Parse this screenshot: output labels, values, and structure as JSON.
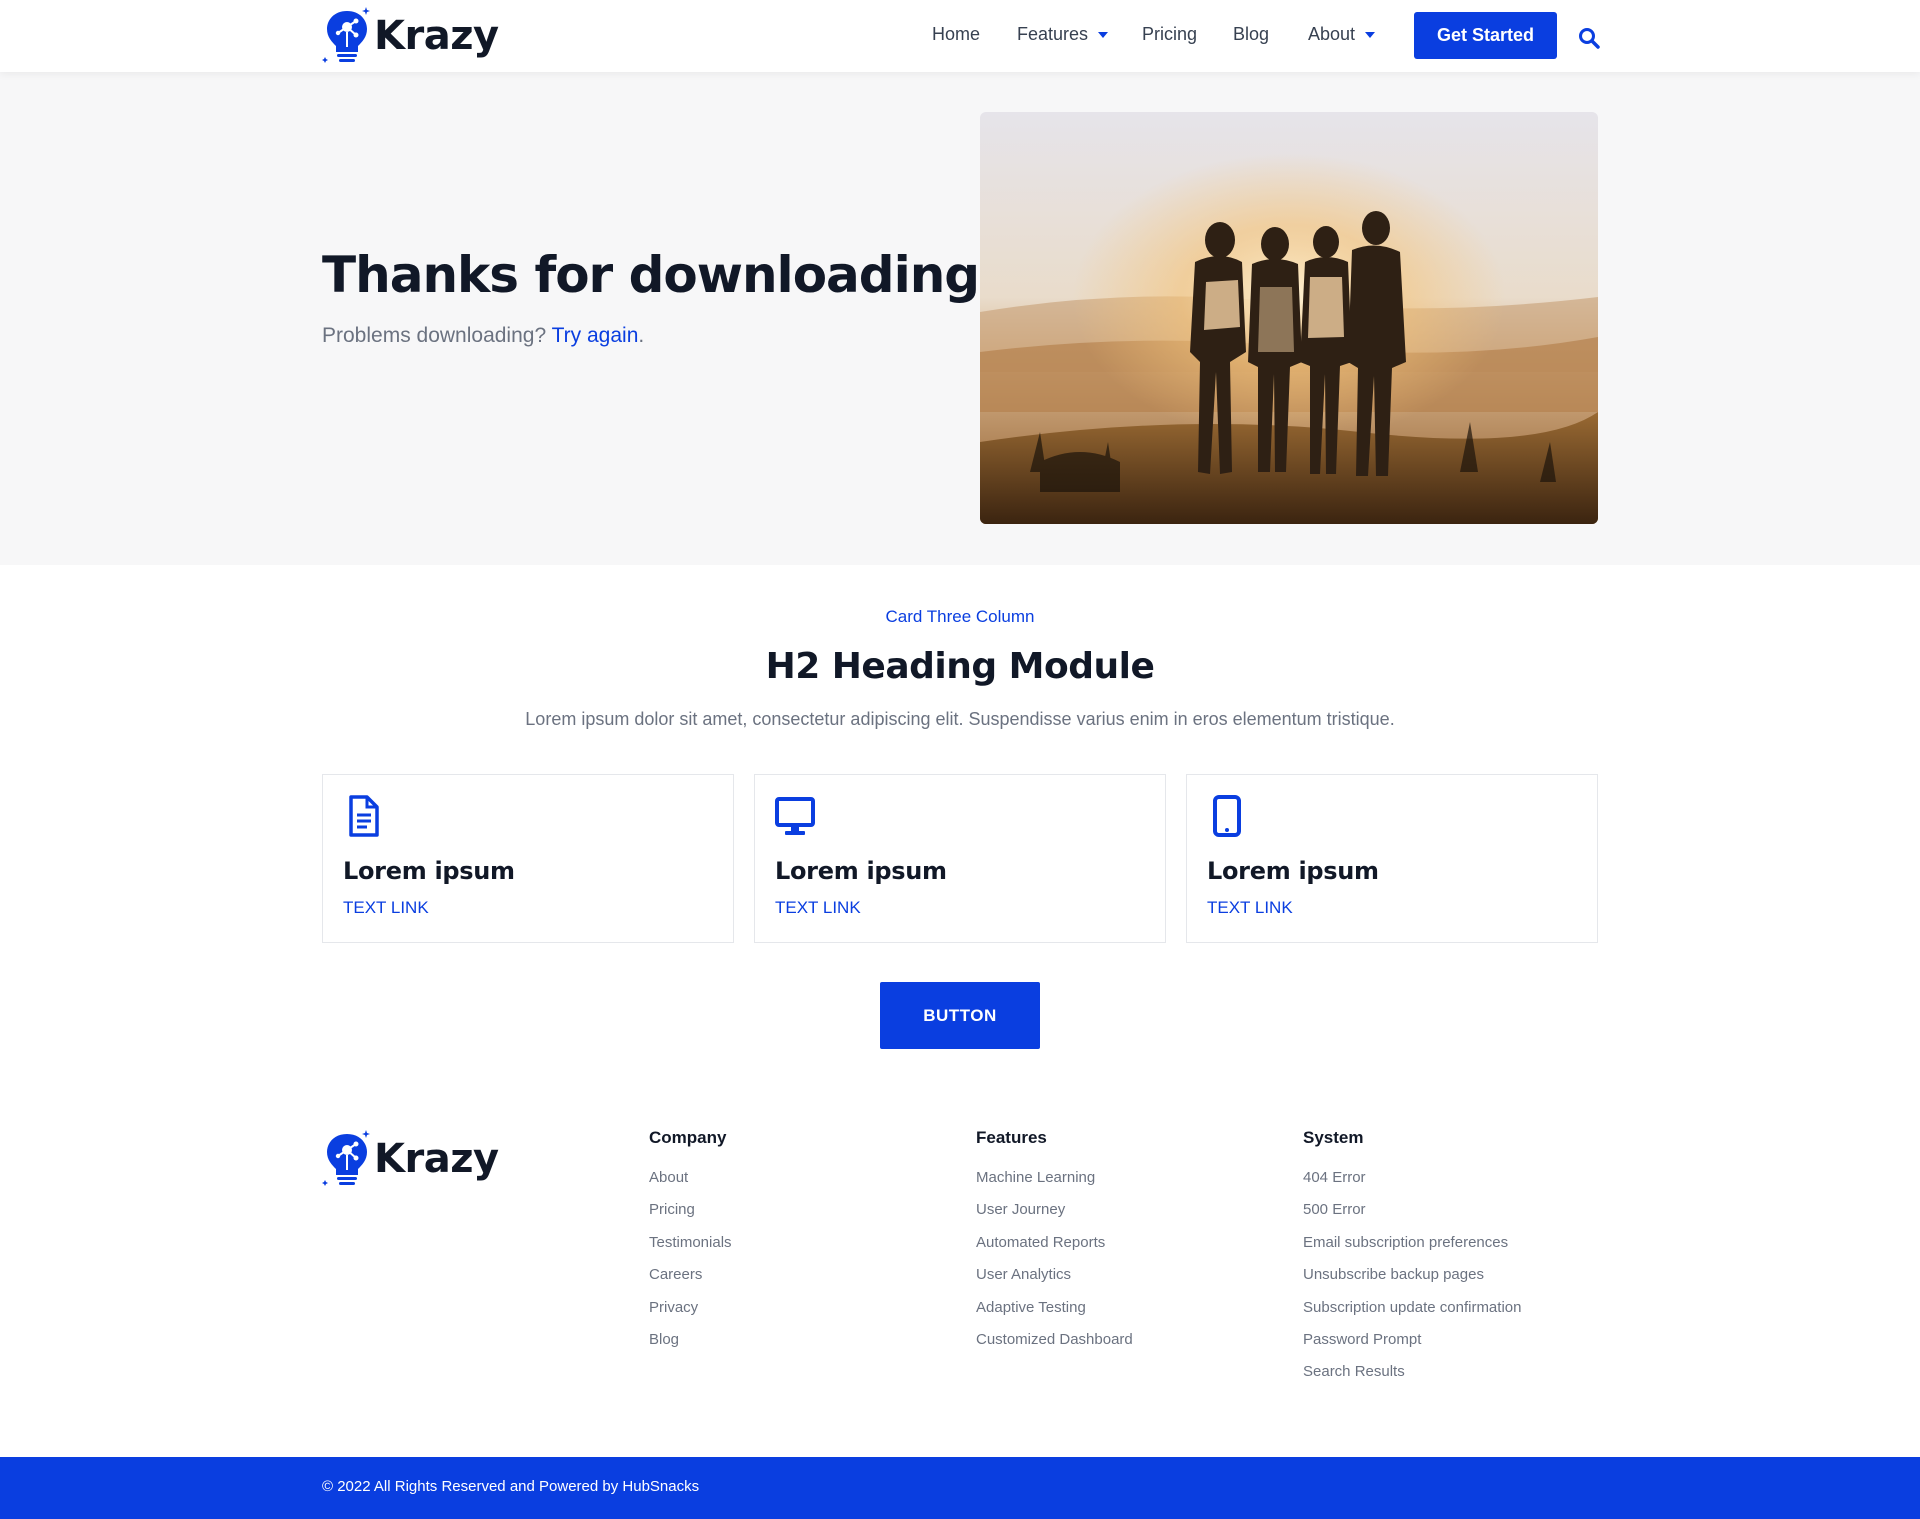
{
  "brand": {
    "name": "Krazy",
    "accent": "#0a3ee0"
  },
  "nav": {
    "items": [
      {
        "label": "Home",
        "dropdown": false
      },
      {
        "label": "Features",
        "dropdown": true
      },
      {
        "label": "Pricing",
        "dropdown": false
      },
      {
        "label": "Blog",
        "dropdown": false
      },
      {
        "label": "About",
        "dropdown": true
      }
    ],
    "cta_label": "Get Started",
    "search_icon": "search-icon"
  },
  "hero": {
    "title": "Thanks for downloading!",
    "sub_prefix": "Problems downloading?",
    "sub_link": "Try again",
    "sub_suffix": "."
  },
  "section": {
    "eyebrow": "Card Three Column",
    "heading": "H2 Heading Module",
    "lead": "Lorem ipsum dolor sit amet, consectetur adipiscing elit. Suspendisse varius enim in eros elementum tristique.",
    "button_label": "BUTTON"
  },
  "cards": [
    {
      "icon": "document-icon",
      "title": "Lorem ipsum",
      "link": "TEXT LINK"
    },
    {
      "icon": "desktop-icon",
      "title": "Lorem ipsum",
      "link": "TEXT LINK"
    },
    {
      "icon": "mobile-icon",
      "title": "Lorem ipsum",
      "link": "TEXT LINK"
    }
  ],
  "footer": {
    "columns": [
      {
        "heading": "Company",
        "links": [
          "About",
          "Pricing",
          "Testimonials",
          "Careers",
          "Privacy",
          "Blog"
        ]
      },
      {
        "heading": "Features",
        "links": [
          "Machine Learning",
          "User Journey",
          "Automated Reports",
          "User Analytics",
          "Adaptive Testing",
          "Customized Dashboard"
        ]
      },
      {
        "heading": "System",
        "links": [
          "404 Error",
          "500 Error",
          "Email subscription preferences",
          "Unsubscribe backup pages",
          "Subscription update confirmation",
          "Password Prompt",
          "Search Results"
        ]
      }
    ],
    "copyright": "© 2022 All Rights Reserved and Powered by HubSnacks"
  }
}
